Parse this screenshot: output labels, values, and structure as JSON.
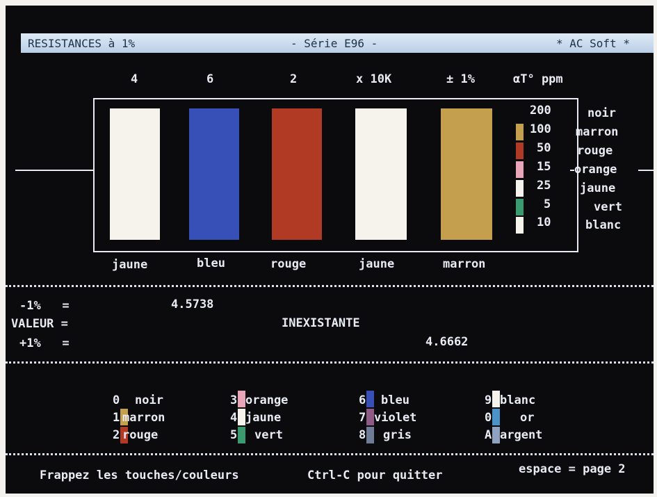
{
  "header": {
    "left": "RESISTANCES à 1%",
    "center": "- Série E96 -",
    "right": "* AC Soft *"
  },
  "digits": {
    "d1": "4",
    "d2": "6",
    "d3": "2",
    "multiplier": "x 10K",
    "tolerance": "± 1%",
    "tc_label": "αT° ppm"
  },
  "bands": {
    "b1": "jaune",
    "b2": "bleu",
    "b3": "rouge",
    "b4": "jaune",
    "b5": "marron"
  },
  "tc_table": {
    "values": [
      "200",
      "100",
      "50",
      "15",
      "25",
      "5",
      "10"
    ],
    "names": [
      "noir",
      "marron",
      "rouge",
      "orange",
      "jaune",
      "vert",
      "blanc"
    ]
  },
  "values_panel": {
    "minus_label": "-1%   =",
    "valeur_label": "VALEUR =",
    "plus_label": "+1%   =",
    "minus_value": "4.5738",
    "status": "INEXISTANTE",
    "plus_value": "4.6662"
  },
  "legend": {
    "c1": [
      {
        "key": "0",
        "name": "noir"
      },
      {
        "key": "1",
        "name": "marron"
      },
      {
        "key": "2",
        "name": "rouge"
      }
    ],
    "c2": [
      {
        "key": "3",
        "name": "orange"
      },
      {
        "key": "4",
        "name": "jaune"
      },
      {
        "key": "5",
        "name": "vert"
      }
    ],
    "c3": [
      {
        "key": "6",
        "name": "bleu"
      },
      {
        "key": "7",
        "name": "violet"
      },
      {
        "key": "8",
        "name": "gris"
      }
    ],
    "c4": [
      {
        "key": "9",
        "name": "blanc"
      },
      {
        "key": "0",
        "name": "or"
      },
      {
        "key": "A",
        "name": "argent"
      }
    ]
  },
  "footer": {
    "left": "Frappez les touches/couleurs",
    "center": "Ctrl-C pour quitter",
    "right": "espace = page 2"
  },
  "colors": {
    "screen_bg": "#0b0b0d",
    "text": "#e9ebf4",
    "title_bar": "#c9dcee",
    "band_white": "#f5f3ec",
    "band_blue": "#3750b8",
    "band_red": "#b13a25",
    "band_brown": "#c4a04e"
  }
}
